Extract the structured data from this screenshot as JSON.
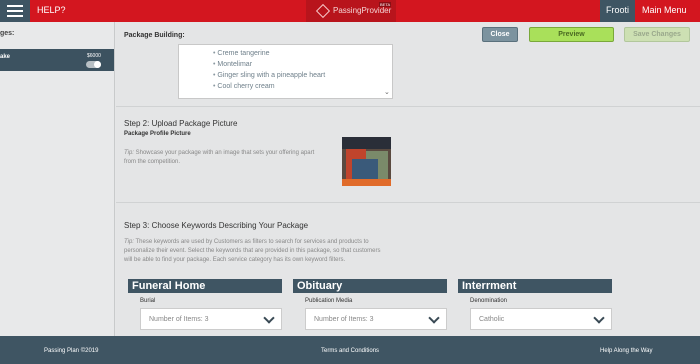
{
  "topbar": {
    "help_label": "HELP?",
    "logo_text": "PassingProvider",
    "logo_badge": "BETA",
    "user_label": "Frooti",
    "main_menu_label": "Main Menu",
    "colors": {
      "brand_red": "#d3161f",
      "nav_slate": "#3e5563"
    }
  },
  "sidebar": {
    "title": "ges:",
    "items": [
      {
        "label": "ake",
        "price": "$6000",
        "toggle_on": true
      }
    ]
  },
  "main": {
    "title": "Package Building:",
    "buttons": {
      "close": "Close",
      "preview": "Preview",
      "save": "Save Changes"
    },
    "list_items": [
      "Creme tangerine",
      "Montelimar",
      "Ginger sling with a pineapple heart",
      "Cool cherry cream"
    ],
    "step2": {
      "heading": "Step 2: Upload Package Picture",
      "sub": "Package Profile Picture",
      "tip_label": "Tip:",
      "tip_text_1": " Showcase your package with an image that sets your offering apart",
      "tip_text_2": "from the competition."
    },
    "step3": {
      "heading": "Step 3: Choose Keywords Describing Your Package",
      "tip_label": "Tip:",
      "tip_text_1": " These keywords are used by Customers as filters to search for services and products to",
      "tip_text_2": "personalize their event. Select the keywords that are provided in this package, so that customers",
      "tip_text_3": "will be able to find your package. Each service category has its own keyword filters."
    },
    "categories": [
      {
        "title": "Funeral Home",
        "field_label": "Burial",
        "value": "Number of Items: 3"
      },
      {
        "title": "Obituary",
        "field_label": "Publication Media",
        "value": "Number of Items: 3"
      },
      {
        "title": "Interrment",
        "field_label": "Denomination",
        "value": "Catholic"
      }
    ]
  },
  "footer": {
    "left": "Passing Plan ©2019",
    "center": "Terms and Conditions",
    "right": "Help Along the Way"
  }
}
